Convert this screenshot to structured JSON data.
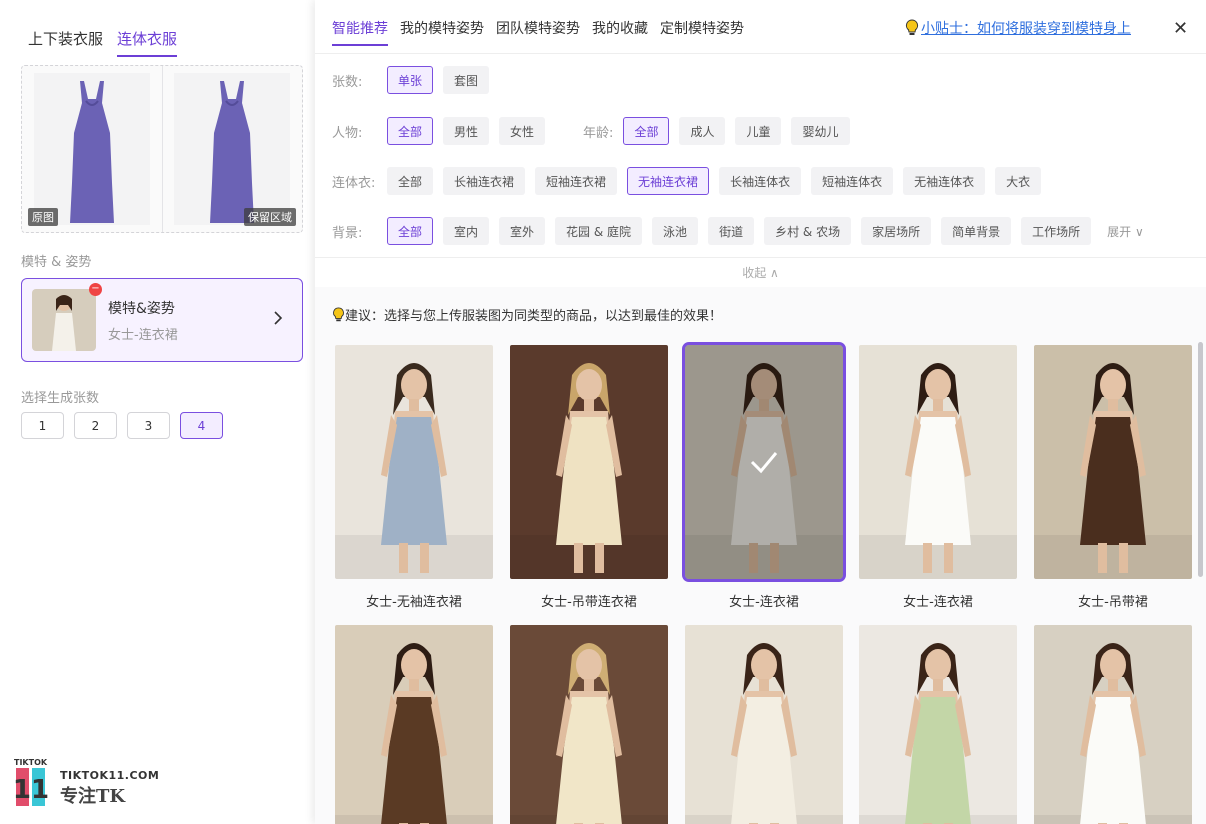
{
  "left": {
    "tabs": [
      {
        "label": "上下装衣服",
        "active": false
      },
      {
        "label": "连体衣服",
        "active": true
      }
    ],
    "garment": {
      "tag_left": "原图",
      "tag_right": "保留区域",
      "color": "#6b62b5"
    },
    "section_model": "模特 & 姿势",
    "model_card": {
      "title": "模特&姿势",
      "subtitle": "女士-连衣裙",
      "badge": "−"
    },
    "section_count": "选择生成张数",
    "counts": [
      {
        "label": "1",
        "active": false
      },
      {
        "label": "2",
        "active": false
      },
      {
        "label": "3",
        "active": false
      },
      {
        "label": "4",
        "active": true
      }
    ],
    "logo": {
      "mark_text": "11",
      "top_small": "TIKTOK",
      "domain": "TIKTOK11.COM",
      "slogan": "专注TK"
    }
  },
  "right": {
    "tabs": [
      {
        "label": "智能推荐",
        "active": true
      },
      {
        "label": "我的模特姿势",
        "active": false
      },
      {
        "label": "团队模特姿势",
        "active": false
      },
      {
        "label": "我的收藏",
        "active": false
      },
      {
        "label": "定制模特姿势",
        "active": false
      }
    ],
    "tip": "小贴士：如何将服装穿到模特身上",
    "close": "✕",
    "filters": {
      "count": {
        "label": "张数:",
        "chips": [
          {
            "label": "单张",
            "active": true
          },
          {
            "label": "套图",
            "active": false
          }
        ]
      },
      "person": {
        "label": "人物:",
        "chips": [
          {
            "label": "全部",
            "active": true
          },
          {
            "label": "男性",
            "active": false
          },
          {
            "label": "女性",
            "active": false
          }
        ]
      },
      "age": {
        "label": "年龄:",
        "chips": [
          {
            "label": "全部",
            "active": true
          },
          {
            "label": "成人",
            "active": false
          },
          {
            "label": "儿童",
            "active": false
          },
          {
            "label": "婴幼儿",
            "active": false
          }
        ]
      },
      "onepiece": {
        "label": "连体衣:",
        "chips": [
          {
            "label": "全部",
            "active": false
          },
          {
            "label": "长袖连衣裙",
            "active": false
          },
          {
            "label": "短袖连衣裙",
            "active": false
          },
          {
            "label": "无袖连衣裙",
            "active": true
          },
          {
            "label": "长袖连体衣",
            "active": false
          },
          {
            "label": "短袖连体衣",
            "active": false
          },
          {
            "label": "无袖连体衣",
            "active": false
          },
          {
            "label": "大衣",
            "active": false
          }
        ]
      },
      "background": {
        "label": "背景:",
        "chips": [
          {
            "label": "全部",
            "active": true
          },
          {
            "label": "室内",
            "active": false
          },
          {
            "label": "室外",
            "active": false
          },
          {
            "label": "花园 & 庭院",
            "active": false
          },
          {
            "label": "泳池",
            "active": false
          },
          {
            "label": "街道",
            "active": false
          },
          {
            "label": "乡村 & 农场",
            "active": false
          },
          {
            "label": "家居场所",
            "active": false
          },
          {
            "label": "简单背景",
            "active": false
          },
          {
            "label": "工作场所",
            "active": false
          }
        ],
        "expand": "展开 ∨"
      }
    },
    "collapse": "收起 ∧",
    "suggest": "建议：选择与您上传服装图为同类型的商品，以达到最佳的效果！",
    "cards": [
      {
        "caption": "女士-无袖连衣裙",
        "bg": "#e9e4dc",
        "dress": "#9fb1c6",
        "hair": "#3a2a1e",
        "selected": false
      },
      {
        "caption": "女士-吊带连衣裙",
        "bg": "#5a3a2c",
        "dress": "#efe2c2",
        "hair": "#c9a56a",
        "selected": false
      },
      {
        "caption": "女士-连衣裙",
        "bg": "#d8d2c4",
        "dress": "#f4f1ea",
        "hair": "#3a2418",
        "selected": true
      },
      {
        "caption": "女士-连衣裙",
        "bg": "#e6e1d6",
        "dress": "#fbfbf8",
        "hair": "#2e1d14",
        "selected": false
      },
      {
        "caption": "女士-吊带裙",
        "bg": "#cbbfa9",
        "dress": "#4a2e1e",
        "hair": "#2e1d14",
        "selected": false
      },
      {
        "caption": "",
        "bg": "#d9cdb9",
        "dress": "#5a3a24",
        "hair": "#2e1d14",
        "selected": false
      },
      {
        "caption": "",
        "bg": "#6a4a38",
        "dress": "#f1e6c8",
        "hair": "#cfae74",
        "selected": false
      },
      {
        "caption": "",
        "bg": "#e7e1d5",
        "dress": "#f3eee2",
        "hair": "#3a2418",
        "selected": false
      },
      {
        "caption": "",
        "bg": "#ece8e2",
        "dress": "#c3d6a7",
        "hair": "#3a2418",
        "selected": false
      },
      {
        "caption": "",
        "bg": "#d7d0c2",
        "dress": "#fbfbf8",
        "hair": "#3a2418",
        "selected": false
      }
    ]
  }
}
